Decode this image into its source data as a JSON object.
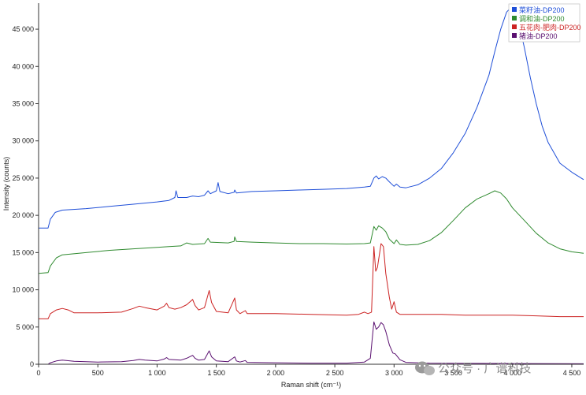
{
  "chart_data": {
    "type": "line",
    "xlabel": "Raman shift (cm⁻¹)",
    "ylabel": "Intensity (counts)",
    "xlim": [
      0,
      4600
    ],
    "ylim": [
      0,
      48500
    ],
    "x_ticks": [
      0,
      500,
      1000,
      1500,
      2000,
      2500,
      3000,
      3500,
      4000,
      4500
    ],
    "x_tick_labels": [
      "0",
      "500",
      "1 000",
      "1 500",
      "2 000",
      "2 500",
      "3 000",
      "3 500",
      "4 000",
      "4 500"
    ],
    "y_ticks": [
      0,
      5000,
      10000,
      15000,
      20000,
      25000,
      30000,
      35000,
      40000,
      45000
    ],
    "y_tick_labels": [
      "0",
      "5 000",
      "10 000",
      "15 000",
      "20 000",
      "25 000",
      "30 000",
      "35 000",
      "40 000",
      "45 000"
    ],
    "grid": false,
    "legend_position": "top-right",
    "series": [
      {
        "name": "菜籽油-DP200",
        "color": "#1f4fd8",
        "points": [
          [
            0,
            18300
          ],
          [
            80,
            18300
          ],
          [
            100,
            19500
          ],
          [
            140,
            20400
          ],
          [
            200,
            20700
          ],
          [
            400,
            20900
          ],
          [
            600,
            21200
          ],
          [
            800,
            21500
          ],
          [
            1000,
            21800
          ],
          [
            1100,
            22000
          ],
          [
            1150,
            22400
          ],
          [
            1160,
            23300
          ],
          [
            1175,
            22400
          ],
          [
            1250,
            22400
          ],
          [
            1300,
            22600
          ],
          [
            1350,
            22500
          ],
          [
            1400,
            22700
          ],
          [
            1430,
            23300
          ],
          [
            1450,
            22900
          ],
          [
            1500,
            23300
          ],
          [
            1515,
            24400
          ],
          [
            1530,
            23200
          ],
          [
            1600,
            22900
          ],
          [
            1650,
            23100
          ],
          [
            1655,
            23400
          ],
          [
            1670,
            23000
          ],
          [
            1800,
            23200
          ],
          [
            2000,
            23300
          ],
          [
            2200,
            23400
          ],
          [
            2400,
            23500
          ],
          [
            2600,
            23600
          ],
          [
            2750,
            23800
          ],
          [
            2800,
            23900
          ],
          [
            2830,
            25000
          ],
          [
            2850,
            25300
          ],
          [
            2870,
            24900
          ],
          [
            2900,
            25200
          ],
          [
            2930,
            25000
          ],
          [
            2960,
            24500
          ],
          [
            3000,
            23900
          ],
          [
            3020,
            24200
          ],
          [
            3050,
            23800
          ],
          [
            3100,
            23700
          ],
          [
            3150,
            23900
          ],
          [
            3200,
            24100
          ],
          [
            3300,
            25000
          ],
          [
            3400,
            26300
          ],
          [
            3500,
            28400
          ],
          [
            3600,
            31000
          ],
          [
            3700,
            34500
          ],
          [
            3800,
            38800
          ],
          [
            3850,
            42000
          ],
          [
            3900,
            45000
          ],
          [
            3950,
            47300
          ],
          [
            3980,
            47800
          ],
          [
            4000,
            47600
          ],
          [
            4050,
            46000
          ],
          [
            4100,
            42500
          ],
          [
            4150,
            38500
          ],
          [
            4200,
            35000
          ],
          [
            4250,
            32000
          ],
          [
            4300,
            29800
          ],
          [
            4400,
            27000
          ],
          [
            4500,
            25800
          ],
          [
            4600,
            24800
          ]
        ]
      },
      {
        "name": "调和油-DP200",
        "color": "#2f8a2f",
        "points": [
          [
            0,
            12200
          ],
          [
            80,
            12300
          ],
          [
            100,
            13200
          ],
          [
            150,
            14300
          ],
          [
            200,
            14700
          ],
          [
            400,
            15000
          ],
          [
            600,
            15300
          ],
          [
            800,
            15500
          ],
          [
            1000,
            15700
          ],
          [
            1100,
            15800
          ],
          [
            1200,
            15900
          ],
          [
            1250,
            16300
          ],
          [
            1300,
            16100
          ],
          [
            1400,
            16200
          ],
          [
            1430,
            16900
          ],
          [
            1450,
            16400
          ],
          [
            1600,
            16300
          ],
          [
            1650,
            16500
          ],
          [
            1655,
            17100
          ],
          [
            1670,
            16500
          ],
          [
            1800,
            16400
          ],
          [
            2000,
            16300
          ],
          [
            2200,
            16200
          ],
          [
            2400,
            16200
          ],
          [
            2600,
            16150
          ],
          [
            2750,
            16200
          ],
          [
            2800,
            16300
          ],
          [
            2830,
            18500
          ],
          [
            2850,
            18000
          ],
          [
            2870,
            18600
          ],
          [
            2900,
            18300
          ],
          [
            2930,
            17800
          ],
          [
            2960,
            16800
          ],
          [
            3000,
            16200
          ],
          [
            3020,
            16700
          ],
          [
            3050,
            16100
          ],
          [
            3100,
            16000
          ],
          [
            3200,
            16100
          ],
          [
            3300,
            16600
          ],
          [
            3400,
            17700
          ],
          [
            3500,
            19300
          ],
          [
            3600,
            21000
          ],
          [
            3700,
            22200
          ],
          [
            3800,
            22900
          ],
          [
            3850,
            23300
          ],
          [
            3900,
            23000
          ],
          [
            3950,
            22200
          ],
          [
            4000,
            21000
          ],
          [
            4100,
            19300
          ],
          [
            4200,
            17600
          ],
          [
            4300,
            16300
          ],
          [
            4400,
            15500
          ],
          [
            4500,
            15100
          ],
          [
            4600,
            14900
          ]
        ]
      },
      {
        "name": "五花肉-肥肉-DP200",
        "color": "#cc2222",
        "points": [
          [
            0,
            6100
          ],
          [
            80,
            6100
          ],
          [
            100,
            6800
          ],
          [
            150,
            7300
          ],
          [
            200,
            7500
          ],
          [
            250,
            7300
          ],
          [
            300,
            6900
          ],
          [
            500,
            6900
          ],
          [
            700,
            7000
          ],
          [
            800,
            7500
          ],
          [
            850,
            7800
          ],
          [
            900,
            7600
          ],
          [
            1000,
            7300
          ],
          [
            1060,
            7800
          ],
          [
            1080,
            8200
          ],
          [
            1100,
            7600
          ],
          [
            1150,
            7400
          ],
          [
            1200,
            7600
          ],
          [
            1250,
            8000
          ],
          [
            1300,
            8700
          ],
          [
            1320,
            7900
          ],
          [
            1350,
            7300
          ],
          [
            1400,
            7600
          ],
          [
            1440,
            9900
          ],
          [
            1460,
            8300
          ],
          [
            1500,
            7100
          ],
          [
            1600,
            6900
          ],
          [
            1655,
            8900
          ],
          [
            1670,
            7300
          ],
          [
            1700,
            6800
          ],
          [
            1745,
            7200
          ],
          [
            1760,
            6800
          ],
          [
            2000,
            6800
          ],
          [
            2300,
            6700
          ],
          [
            2600,
            6600
          ],
          [
            2700,
            6700
          ],
          [
            2750,
            7000
          ],
          [
            2780,
            6800
          ],
          [
            2810,
            7000
          ],
          [
            2830,
            15800
          ],
          [
            2845,
            12500
          ],
          [
            2860,
            13000
          ],
          [
            2890,
            16200
          ],
          [
            2910,
            15800
          ],
          [
            2930,
            12200
          ],
          [
            2960,
            9000
          ],
          [
            2980,
            7400
          ],
          [
            3000,
            8400
          ],
          [
            3020,
            7000
          ],
          [
            3050,
            6700
          ],
          [
            3200,
            6700
          ],
          [
            3400,
            6700
          ],
          [
            3600,
            6600
          ],
          [
            3800,
            6600
          ],
          [
            4000,
            6600
          ],
          [
            4200,
            6500
          ],
          [
            4400,
            6400
          ],
          [
            4600,
            6400
          ]
        ]
      },
      {
        "name": "猪油-DP200",
        "color": "#5a1070",
        "points": [
          [
            0,
            0
          ],
          [
            80,
            0
          ],
          [
            100,
            200
          ],
          [
            150,
            450
          ],
          [
            200,
            550
          ],
          [
            300,
            400
          ],
          [
            500,
            300
          ],
          [
            700,
            350
          ],
          [
            800,
            500
          ],
          [
            850,
            650
          ],
          [
            900,
            550
          ],
          [
            1000,
            450
          ],
          [
            1060,
            700
          ],
          [
            1080,
            900
          ],
          [
            1100,
            650
          ],
          [
            1200,
            550
          ],
          [
            1250,
            800
          ],
          [
            1300,
            1200
          ],
          [
            1320,
            800
          ],
          [
            1350,
            550
          ],
          [
            1400,
            650
          ],
          [
            1440,
            1800
          ],
          [
            1460,
            1000
          ],
          [
            1500,
            450
          ],
          [
            1600,
            350
          ],
          [
            1655,
            1000
          ],
          [
            1670,
            450
          ],
          [
            1700,
            300
          ],
          [
            1745,
            500
          ],
          [
            1760,
            250
          ],
          [
            2000,
            200
          ],
          [
            2300,
            150
          ],
          [
            2600,
            150
          ],
          [
            2750,
            300
          ],
          [
            2800,
            800
          ],
          [
            2830,
            5700
          ],
          [
            2850,
            4700
          ],
          [
            2870,
            5000
          ],
          [
            2890,
            5600
          ],
          [
            2910,
            5300
          ],
          [
            2930,
            4400
          ],
          [
            2960,
            2600
          ],
          [
            2990,
            1500
          ],
          [
            3010,
            1400
          ],
          [
            3050,
            600
          ],
          [
            3100,
            250
          ],
          [
            3300,
            150
          ],
          [
            3600,
            120
          ],
          [
            4000,
            100
          ],
          [
            4600,
            60
          ]
        ]
      }
    ]
  },
  "watermark": "公众号 · 广谱科技"
}
